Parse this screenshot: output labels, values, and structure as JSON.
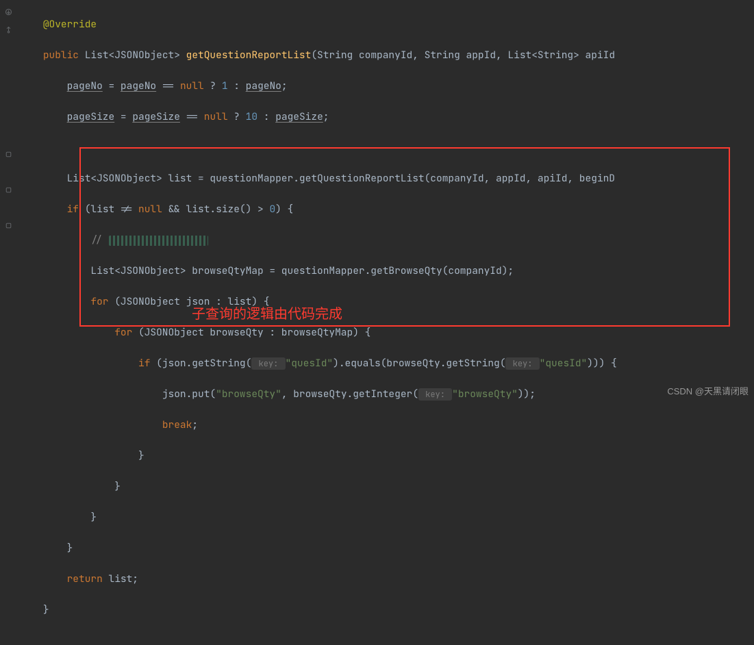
{
  "code": {
    "l1_annotation": "@Override",
    "l2_public": "public",
    "l2_listtype": "List<JSONObject>",
    "l2_method": "getQuestionReportList",
    "l2_params": "(String companyId, String appId, List<String> apiId",
    "l3_a": "pageNo",
    "l3_b": " = ",
    "l3_c": "pageNo",
    "l3_d": " == ",
    "l3_e": "null",
    "l3_f": " ? ",
    "l3_g": "1",
    "l3_h": " : ",
    "l3_i": "pageNo",
    "l3_j": ";",
    "l4_a": "pageSize",
    "l4_b": " = ",
    "l4_c": "pageSize",
    "l4_d": " == ",
    "l4_e": "null",
    "l4_f": " ? ",
    "l4_g": "10",
    "l4_h": " : ",
    "l4_i": "pageSize",
    "l4_j": ";",
    "l6": "List<JSONObject> list = questionMapper.getQuestionReportList(companyId, appId, apiId, beginD",
    "l7_if": "if",
    "l7_cond": " (list != ",
    "l7_null": "null",
    "l7_rest": " && list.size() > ",
    "l7_zero": "0",
    "l7_end": ") {",
    "l8_slash": "// ",
    "l9": "List<JSONObject> browseQtyMap = questionMapper.getBrowseQty(companyId);",
    "l10_for": "for",
    "l10_rest": " (JSONObject json : list) {",
    "l11_for": "for",
    "l11_rest": " (JSONObject browseQty : browseQtyMap) {",
    "l12_if": "if",
    "l12_a": " (json.getString(",
    "l12_hint1": " key: ",
    "l12_s1": "\"quesId\"",
    "l12_b": ").equals(browseQty.getString(",
    "l12_hint2": " key: ",
    "l12_s2": "\"quesId\"",
    "l12_c": "))) {",
    "l13_a": "json.put(",
    "l13_s1": "\"browseQty\"",
    "l13_b": ", browseQty.getInteger(",
    "l13_hint": " key: ",
    "l13_s2": "\"browseQty\"",
    "l13_c": "));",
    "l14_break": "break",
    "l14_semi": ";",
    "l15": "}",
    "l16": "}",
    "l17": "}",
    "l18": "}",
    "l19_ret": "return",
    "l19_val": " list;",
    "l20": "}"
  },
  "annotation_label": "子查询的逻辑由代码完成",
  "watermark": "CSDN @天黑请闭眼"
}
